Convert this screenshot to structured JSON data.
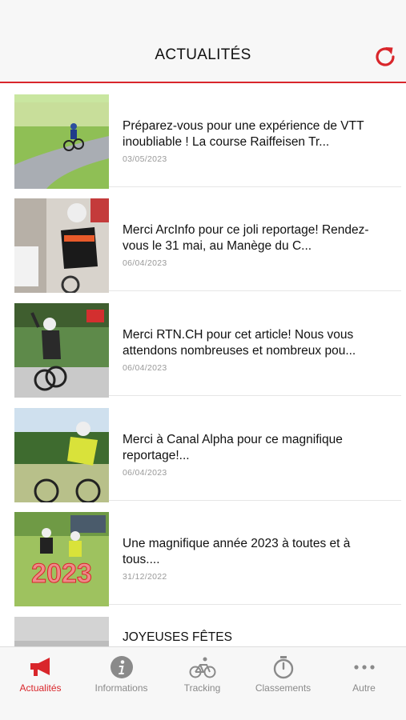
{
  "header": {
    "title": "ACTUALITÉS",
    "refresh_icon": "refresh-icon",
    "accent": "#d9262b"
  },
  "news": [
    {
      "title": "Préparez-vous pour une expérience de VTT inoubliable ! La course Raiffeisen Tr...",
      "date": "03/05/2023"
    },
    {
      "title": "Merci ArcInfo pour ce joli reportage! Rendez-vous le 31 mai, au Manège du C...",
      "date": "06/04/2023"
    },
    {
      "title": "Merci RTN.CH pour cet article! Nous vous attendons nombreuses et nombreux pou...",
      "date": "06/04/2023"
    },
    {
      "title": "Merci à Canal Alpha pour ce magnifique reportage!...",
      "date": "06/04/2023"
    },
    {
      "title": "Une magnifique année 2023 à toutes et à tous....",
      "date": "31/12/2022",
      "image_text": "2023"
    },
    {
      "title": "JOYEUSES FÊTES",
      "date": ""
    }
  ],
  "tabs": [
    {
      "label": "Actualités",
      "icon": "megaphone-icon",
      "active": true
    },
    {
      "label": "Informations",
      "icon": "info-icon",
      "active": false
    },
    {
      "label": "Tracking",
      "icon": "bicycle-icon",
      "active": false
    },
    {
      "label": "Classements",
      "icon": "stopwatch-icon",
      "active": false
    },
    {
      "label": "Autre",
      "icon": "more-icon",
      "active": false
    }
  ]
}
